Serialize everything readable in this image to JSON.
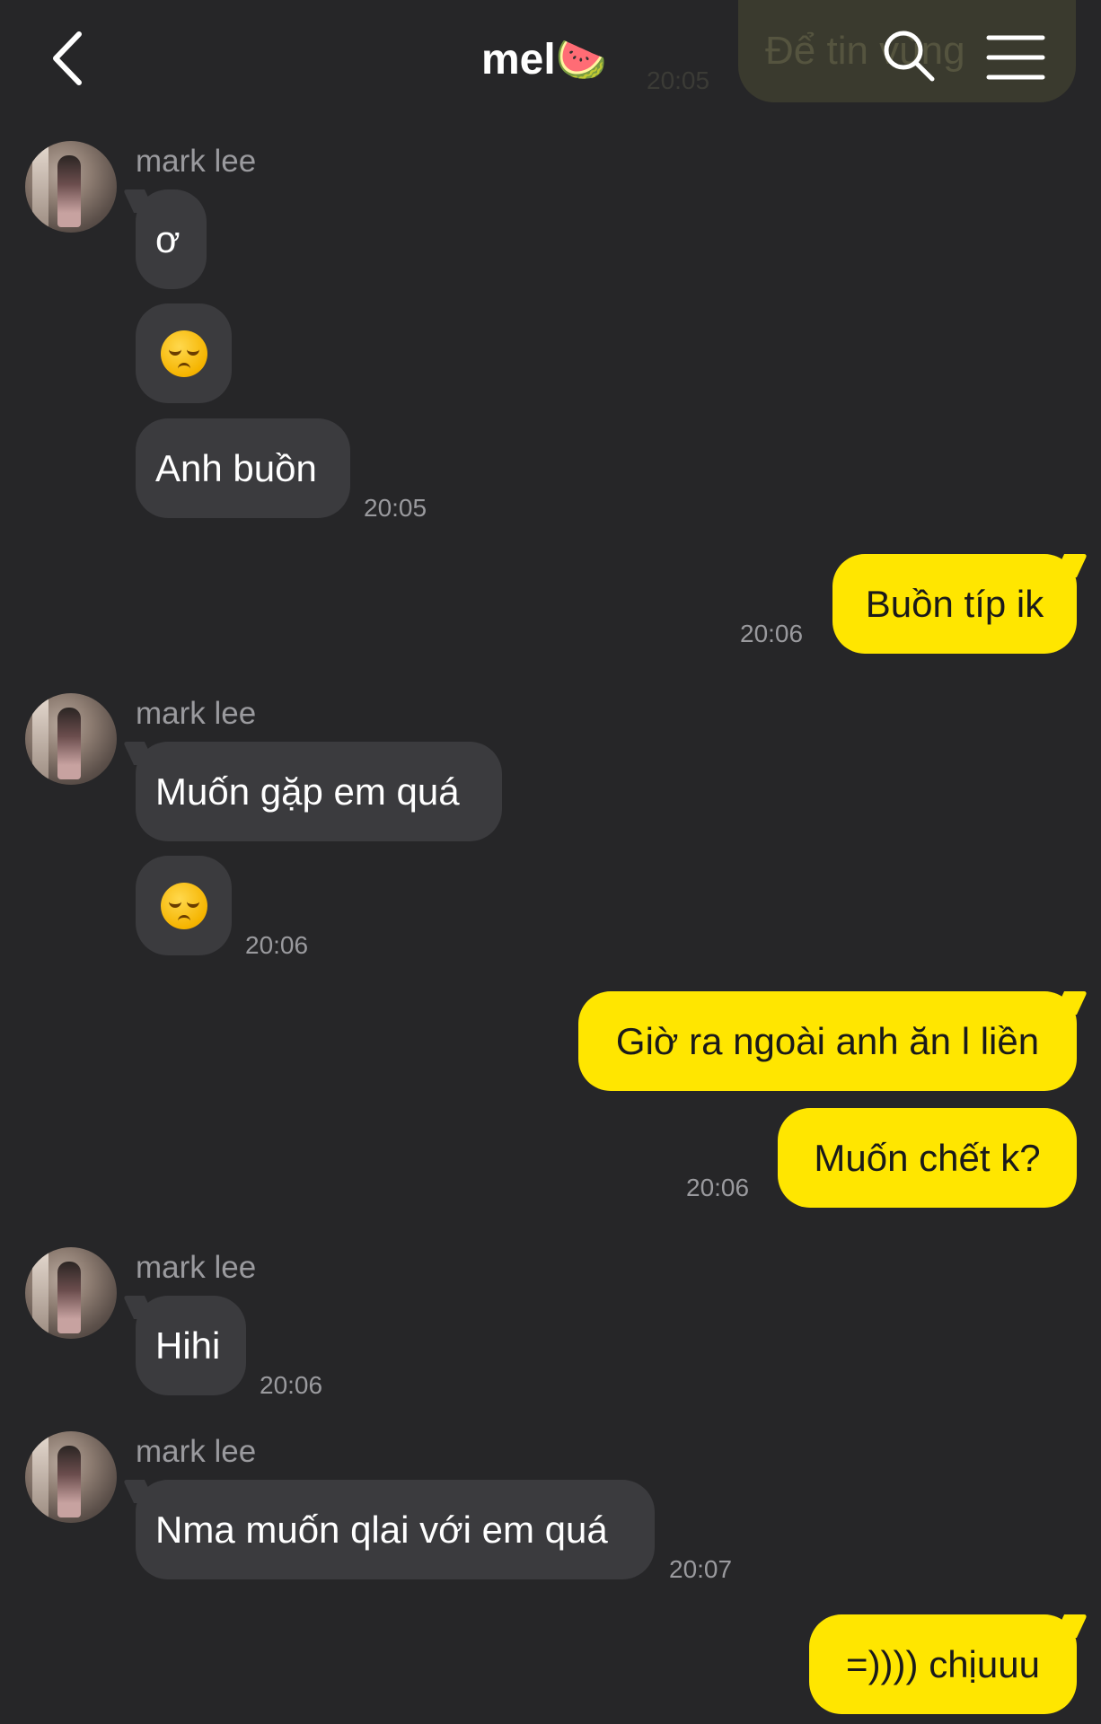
{
  "header": {
    "chat_name": "mel",
    "chat_emoji": "🍉",
    "back_icon": "chevron-left-icon",
    "search_icon": "search-icon",
    "menu_icon": "hamburger-menu-icon"
  },
  "ghost": {
    "text": "Để tin vùng",
    "time": "20:05"
  },
  "messages": {
    "g1": {
      "sender": "mark lee",
      "m1": "ơ",
      "m3": "Anh buồn",
      "time": "20:05"
    },
    "o1": {
      "text": "Buồn típ ik",
      "time": "20:06"
    },
    "g2": {
      "sender": "mark lee",
      "m1": "Muốn gặp em quá",
      "time": "20:06"
    },
    "o2": {
      "text1": "Giờ ra ngoài anh ăn l liền",
      "text2": "Muốn chết k?",
      "time": "20:06"
    },
    "g3": {
      "sender": "mark lee",
      "m1": "Hihi",
      "time": "20:06"
    },
    "g4": {
      "sender": "mark lee",
      "m1": "Nma muốn qlai với em quá",
      "time": "20:07"
    },
    "o3": {
      "text": "=)))) chịuuu"
    }
  },
  "colors": {
    "background": "#262628",
    "incoming_bubble": "#3b3b3e",
    "outgoing_bubble": "#ffe600",
    "timestamp": "#9a9a9e"
  }
}
